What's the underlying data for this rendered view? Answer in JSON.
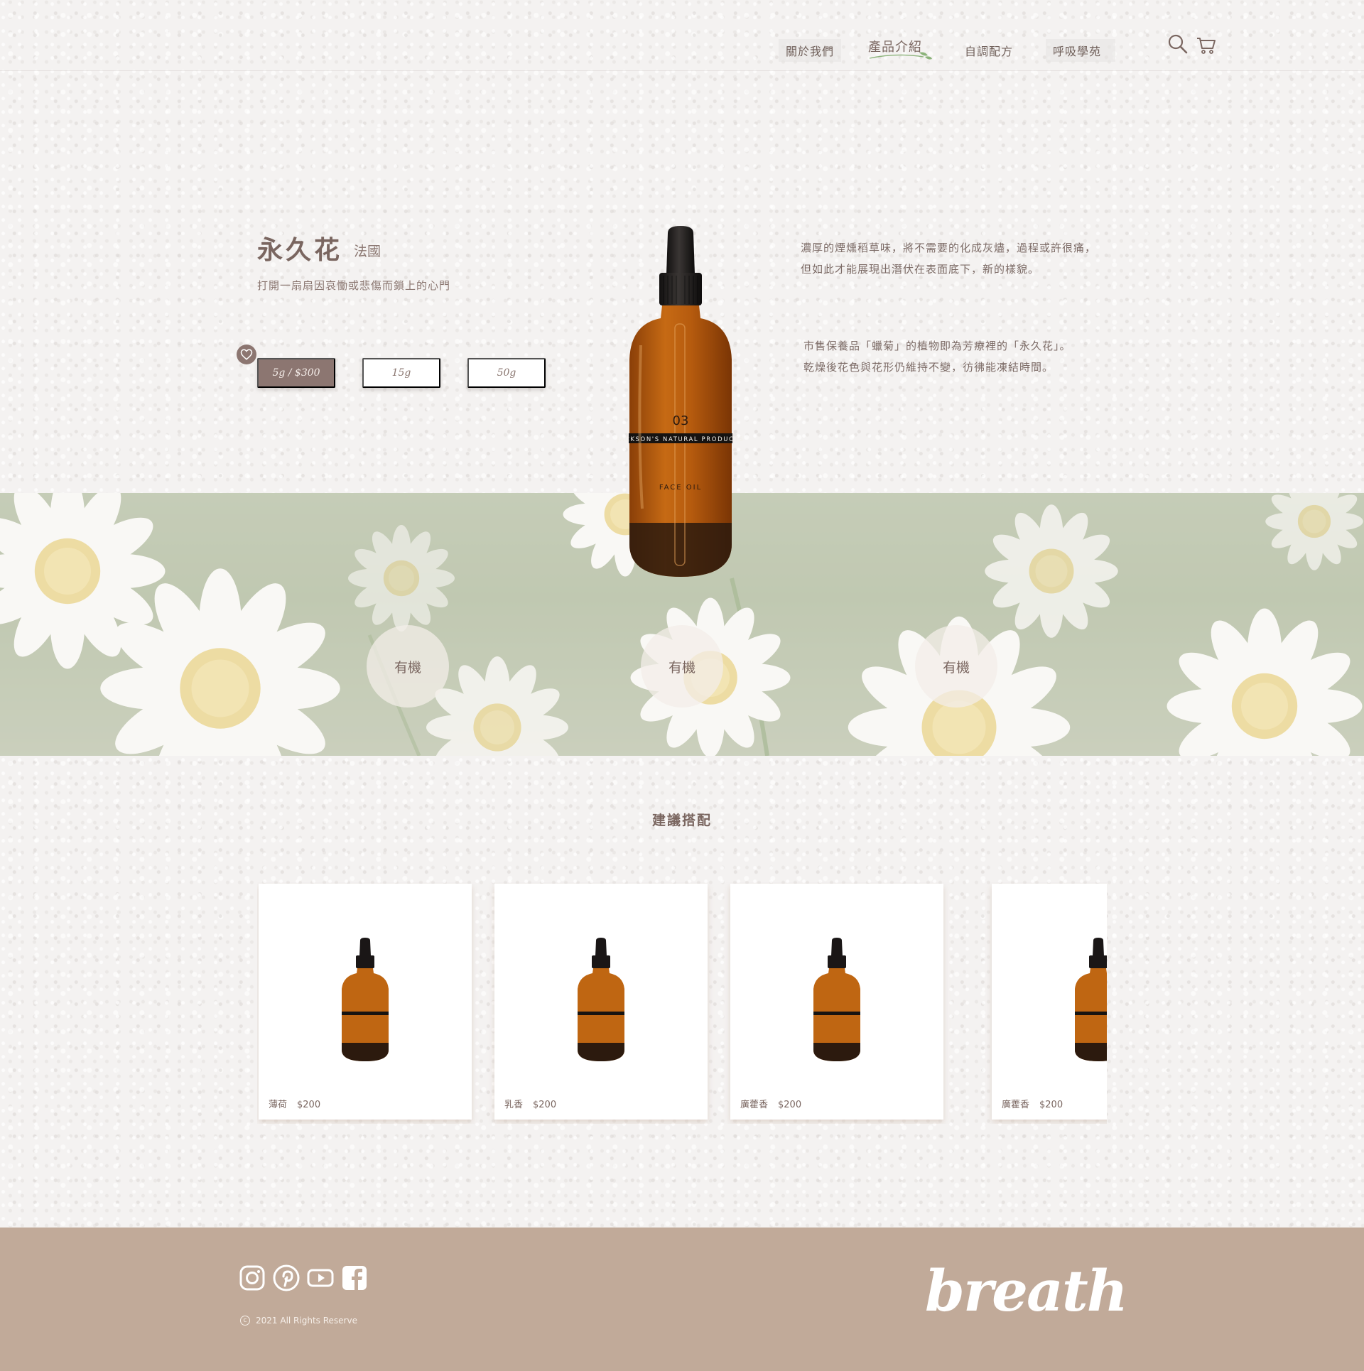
{
  "nav": {
    "items": [
      {
        "label": "關於我們"
      },
      {
        "label": "產品介紹"
      },
      {
        "label": "自調配方"
      },
      {
        "label": "呼吸學苑"
      }
    ]
  },
  "icons": {
    "search": "search-icon",
    "cart": "cart-icon",
    "favorite": "heart-icon",
    "instagram": "instagram-icon",
    "pinterest": "pinterest-icon",
    "youtube": "youtube-icon",
    "facebook": "facebook-icon"
  },
  "product": {
    "name": "永久花",
    "origin": "法國",
    "tagline": "打開一扇扇因哀慟或悲傷而鎖上的心門",
    "sizes": [
      {
        "label": "5g / $300",
        "selected": true
      },
      {
        "label": "15g",
        "selected": false
      },
      {
        "label": "50g",
        "selected": false
      }
    ],
    "description_1": [
      "濃厚的煙燻稻草味，將不需要的化成灰燼，過程或許很痛，",
      "但如此才能展現出潛伏在表面底下，新的樣貌。"
    ],
    "description_2": [
      "市售保養品「蠟菊」的植物即為芳療裡的「永久花」。",
      "乾燥後花色與花形仍維持不變，彷彿能凍結時間。"
    ],
    "bottle_label": {
      "number": "03",
      "band": "JACKSON'S NATURAL PRODUCTS",
      "type": "FACE OIL"
    }
  },
  "badges": [
    "有機",
    "有機",
    "有機"
  ],
  "recommend": {
    "title": "建議搭配",
    "items": [
      {
        "name": "薄荷",
        "price": "$200"
      },
      {
        "name": "乳香",
        "price": "$200"
      },
      {
        "name": "廣藿香",
        "price": "$200"
      },
      {
        "name": "廣藿香",
        "price": "$200"
      }
    ]
  },
  "footer": {
    "copyright": "2021 All Rights Reserve",
    "logo": "breath"
  },
  "colors": {
    "accent": "#8c7671",
    "footer": "#c1aa99",
    "text": "#7a6660",
    "amber": "#b05a12"
  }
}
